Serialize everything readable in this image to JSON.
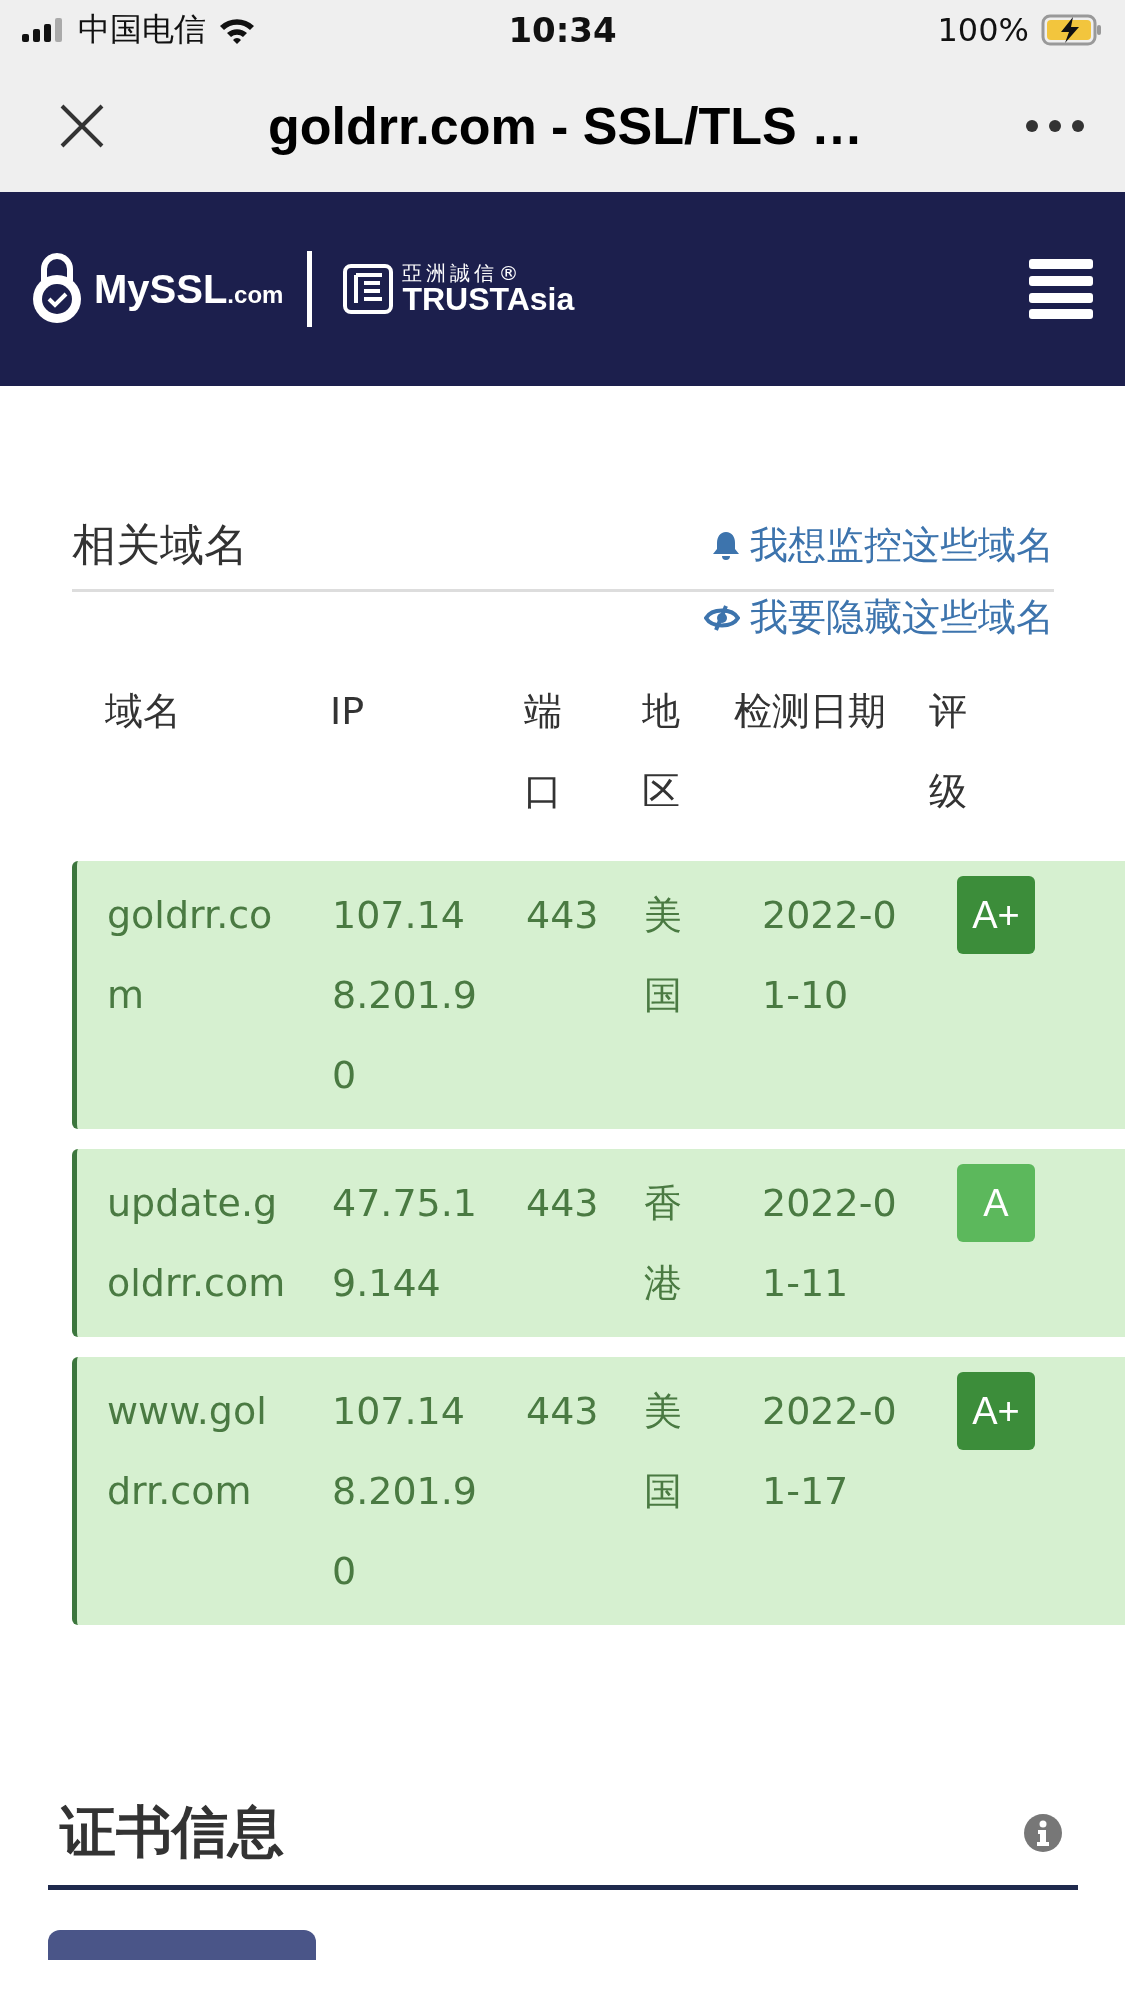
{
  "status_bar": {
    "carrier": "中国电信",
    "time": "10:34",
    "battery": "100%",
    "charging": true
  },
  "browser_bar": {
    "title": "goldrr.com - SSL/TLS …"
  },
  "header": {
    "brand": "MySSL",
    "brand_suffix": ".com",
    "partner_cn": "亞洲誠信",
    "partner_mark": "®",
    "partner_en": "TRUSTAsia"
  },
  "related_domains": {
    "title": "相关域名",
    "actions": [
      {
        "kind": "bell",
        "label": "我想监控这些域名"
      },
      {
        "kind": "eye",
        "label": "我要隐藏这些域名"
      }
    ],
    "columns": [
      "域名",
      "IP",
      "端口",
      "地区",
      "检测日期",
      "评级"
    ],
    "rows": [
      {
        "domain": "goldrr.com",
        "ip": "107.148.201.90",
        "port": "443",
        "region": "美国",
        "date": "2022-01-10",
        "grade": "A+",
        "color": "#3c8d3a"
      },
      {
        "domain": "update.goldrr.com",
        "ip": "47.75.19.144",
        "port": "443",
        "region": "香港",
        "date": "2022-01-11",
        "grade": "A",
        "color": "#5cb85c"
      },
      {
        "domain": "www.goldrr.com",
        "ip": "107.148.201.90",
        "port": "443",
        "region": "美国",
        "date": "2022-01-17",
        "grade": "A+",
        "color": "#3c8d3a"
      }
    ]
  },
  "certificate": {
    "title": "证书信息"
  }
}
